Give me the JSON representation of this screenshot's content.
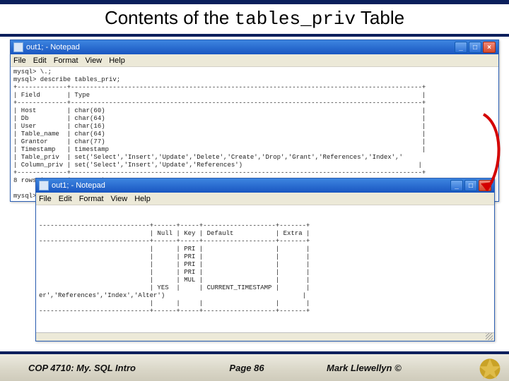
{
  "slide": {
    "title_plain": "Contents of the ",
    "title_mono": "tables_priv",
    "title_after": " Table"
  },
  "np1": {
    "title": "out1; - Notepad",
    "menu": {
      "file": "File",
      "edit": "Edit",
      "format": "Format",
      "view": "View",
      "help": "Help"
    },
    "content": "mysql> \\.;\nmysql> describe tables_priv;\n+-------------+--------------------------------------------------------------------------------------------+\n| Field       | Type                                                                                       |\n+-------------+--------------------------------------------------------------------------------------------+\n| Host        | char(60)                                                                                   |\n| Db          | char(64)                                                                                   |\n| User        | char(16)                                                                                   |\n| Table_name  | char(64)                                                                                   |\n| Grantor     | char(77)                                                                                   |\n| Timestamp   | timestamp                                                                                  |\n| Table_priv  | set('Select','Insert','Update','Delete','Create','Drop','Grant','References','Index','\n| Column_priv | set('Select','Insert','Update','References')                                              |\n+-------------+--------------------------------------------------------------------------------------------+\n8 rows in set (0.00 sec)\n\nmysql>"
  },
  "np2": {
    "title": "out1; - Notepad",
    "menu": {
      "file": "File",
      "edit": "Edit",
      "format": "Format",
      "view": "View",
      "help": "Help"
    },
    "content": "\n\n-----------------------------+------+-----+-------------------+-------+\n                             | Null | Key | Default           | Extra |\n-----------------------------+------+-----+-------------------+-------+\n                             |      | PRI |                   |       |\n                             |      | PRI |                   |       |\n                             |      | PRI |                   |       |\n                             |      | PRI |                   |       |\n                             |      | MUL |                   |       |\n                             | YES  |     | CURRENT_TIMESTAMP |       |\ner','References','Index','Alter')                                    |\n                             |      |     |                   |       |\n-----------------------------+------+-----+-------------------+-------+\n\n"
  },
  "footer": {
    "left": "COP 4710: My. SQL Intro",
    "center": "Page 86",
    "right": "Mark Llewellyn ©"
  },
  "icons": {
    "minimize": "_",
    "maximize": "□",
    "close": "×"
  }
}
